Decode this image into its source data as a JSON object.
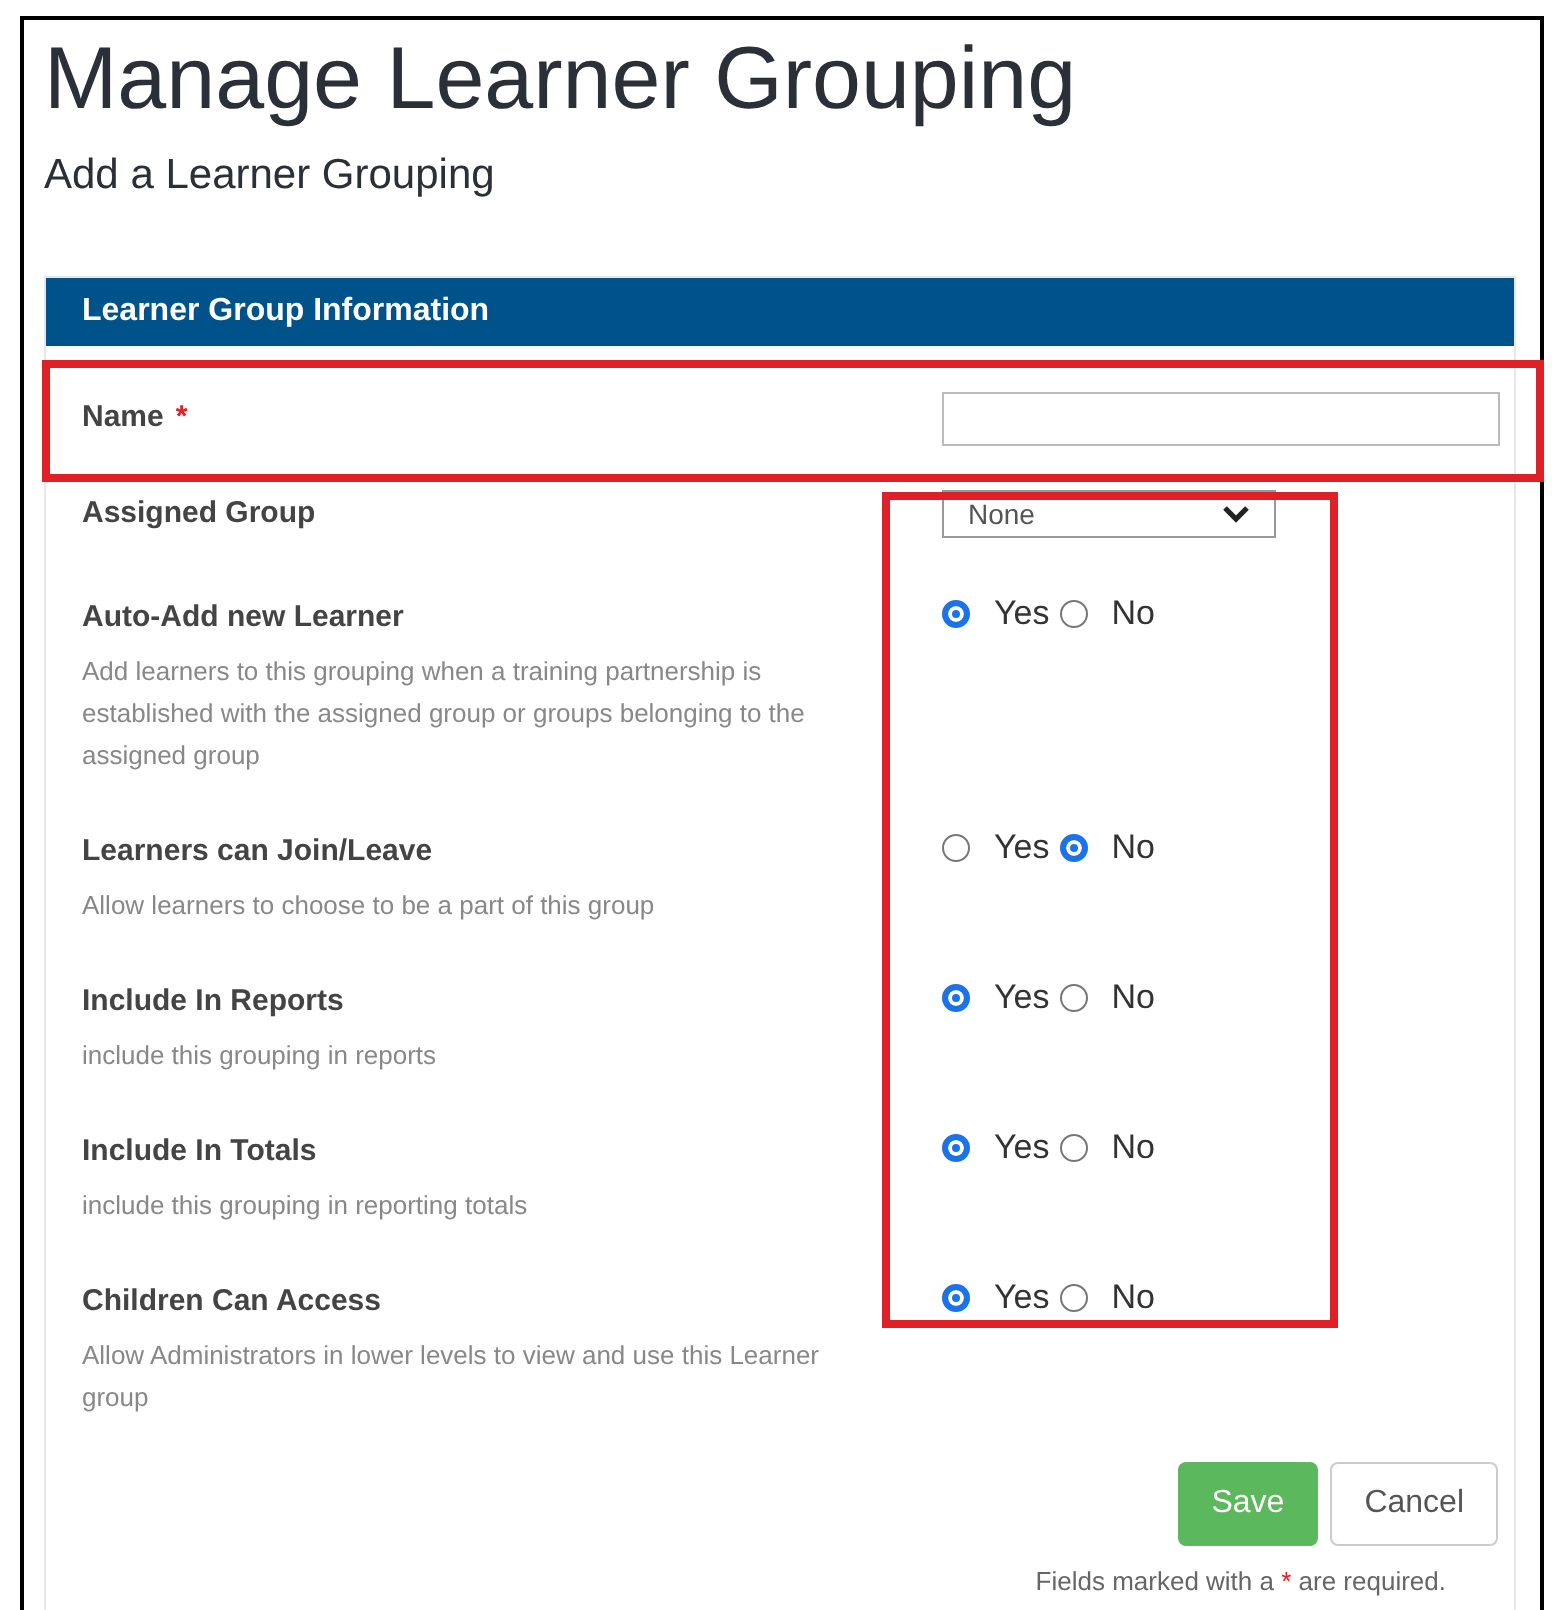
{
  "page": {
    "title": "Manage Learner Grouping",
    "subtitle": "Add a Learner Grouping"
  },
  "section": {
    "title": "Learner Group Information"
  },
  "fields": [
    {
      "kind": "text",
      "label": "Name",
      "required_mark": "*"
    },
    {
      "kind": "select",
      "label": "Assigned Group",
      "value": "None"
    },
    {
      "kind": "radio",
      "label": "Auto-Add new Learner",
      "description": "Add learners to this grouping when a training partnership is established with the assigned group or groups belonging to the assigned group",
      "options": [
        {
          "label": "Yes",
          "selected": true
        },
        {
          "label": "No",
          "selected": false
        }
      ]
    },
    {
      "kind": "radio",
      "label": "Learners can Join/Leave",
      "description": "Allow learners to choose to be a part of this group",
      "options": [
        {
          "label": "Yes",
          "selected": false
        },
        {
          "label": "No",
          "selected": true
        }
      ]
    },
    {
      "kind": "radio",
      "label": "Include In Reports",
      "description": "include this grouping in reports",
      "options": [
        {
          "label": "Yes",
          "selected": true
        },
        {
          "label": "No",
          "selected": false
        }
      ]
    },
    {
      "kind": "radio",
      "label": "Include In Totals",
      "description": "include this grouping in reporting totals",
      "options": [
        {
          "label": "Yes",
          "selected": true
        },
        {
          "label": "No",
          "selected": false
        }
      ]
    },
    {
      "kind": "radio",
      "label": "Children Can Access",
      "description": "Allow Administrators in lower levels to view and use this Learner group",
      "options": [
        {
          "label": "Yes",
          "selected": true
        },
        {
          "label": "No",
          "selected": false
        }
      ]
    }
  ],
  "buttons": [
    {
      "label": "Save",
      "kind": "primary"
    },
    {
      "label": "Cancel",
      "kind": "secondary"
    }
  ],
  "footnote": {
    "before": "Fields marked with a",
    "mark": "*",
    "after": "are required."
  }
}
